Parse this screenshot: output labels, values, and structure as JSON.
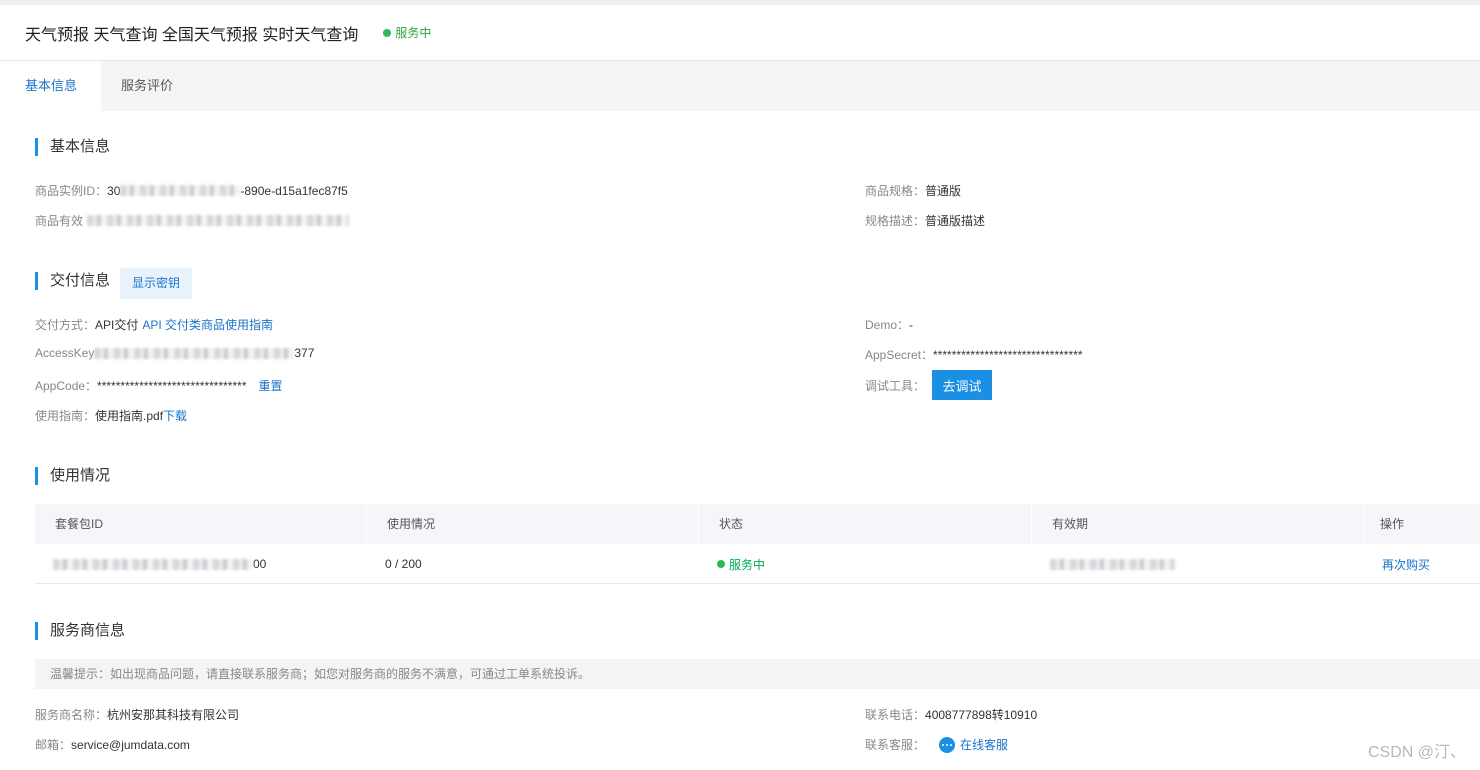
{
  "header": {
    "title": "天气预报 天气查询 全国天气预报 实时天气查询",
    "status": "服务中"
  },
  "tabs": [
    {
      "label": "基本信息"
    },
    {
      "label": "服务评价"
    }
  ],
  "basic": {
    "section_title": "基本信息",
    "instance_id_label": "商品实例ID：",
    "instance_id_prefix": "30",
    "instance_id_suffix": "-890e-d15a1fec87f5",
    "valid_label": "商品有效",
    "spec_label": "商品规格：",
    "spec_value": "普通版",
    "spec_desc_label": "规格描述：",
    "spec_desc_value": "普通版描述"
  },
  "delivery": {
    "section_title": "交付信息",
    "show_key_button": "显示密钥",
    "method_label": "交付方式：",
    "method_value": "API交付",
    "method_link": "API 交付类商品使用指南",
    "access_key_label": "AccessKey",
    "access_key_suffix": "377",
    "appcode_label": "AppCode：",
    "appcode_value": "********************************",
    "reset_link": "重置",
    "guide_label": "使用指南：",
    "guide_value": "使用指南.pdf",
    "download_link": "下载",
    "demo_label": "Demo：",
    "demo_value": "-",
    "appsecret_label": "AppSecret：",
    "appsecret_value": "********************************",
    "debug_label": "调试工具：",
    "debug_button": "去调试"
  },
  "usage": {
    "section_title": "使用情况",
    "columns": [
      "套餐包ID",
      "使用情况",
      "状态",
      "有效期",
      "操作"
    ],
    "rows": [
      {
        "package_id_suffix": "00",
        "usage": "0 / 200",
        "status": "服务中",
        "action": "再次购买"
      }
    ]
  },
  "provider": {
    "section_title": "服务商信息",
    "notice": "温馨提示：如出现商品问题，请直接联系服务商；如您对服务商的服务不满意，可通过工单系统投诉。",
    "name_label": "服务商名称：",
    "name_value": "杭州安那其科技有限公司",
    "email_label": "邮箱：",
    "email_value": "service@jumdata.com",
    "phone_label": "联系电话：",
    "phone_value": "4008777898转10910",
    "support_label": "联系客服：",
    "support_link": "在线客服"
  },
  "watermark": "CSDN @汀、",
  "colors": {
    "accent": "#1a8fe3",
    "link": "#1a73c9",
    "status": "#29a744"
  }
}
